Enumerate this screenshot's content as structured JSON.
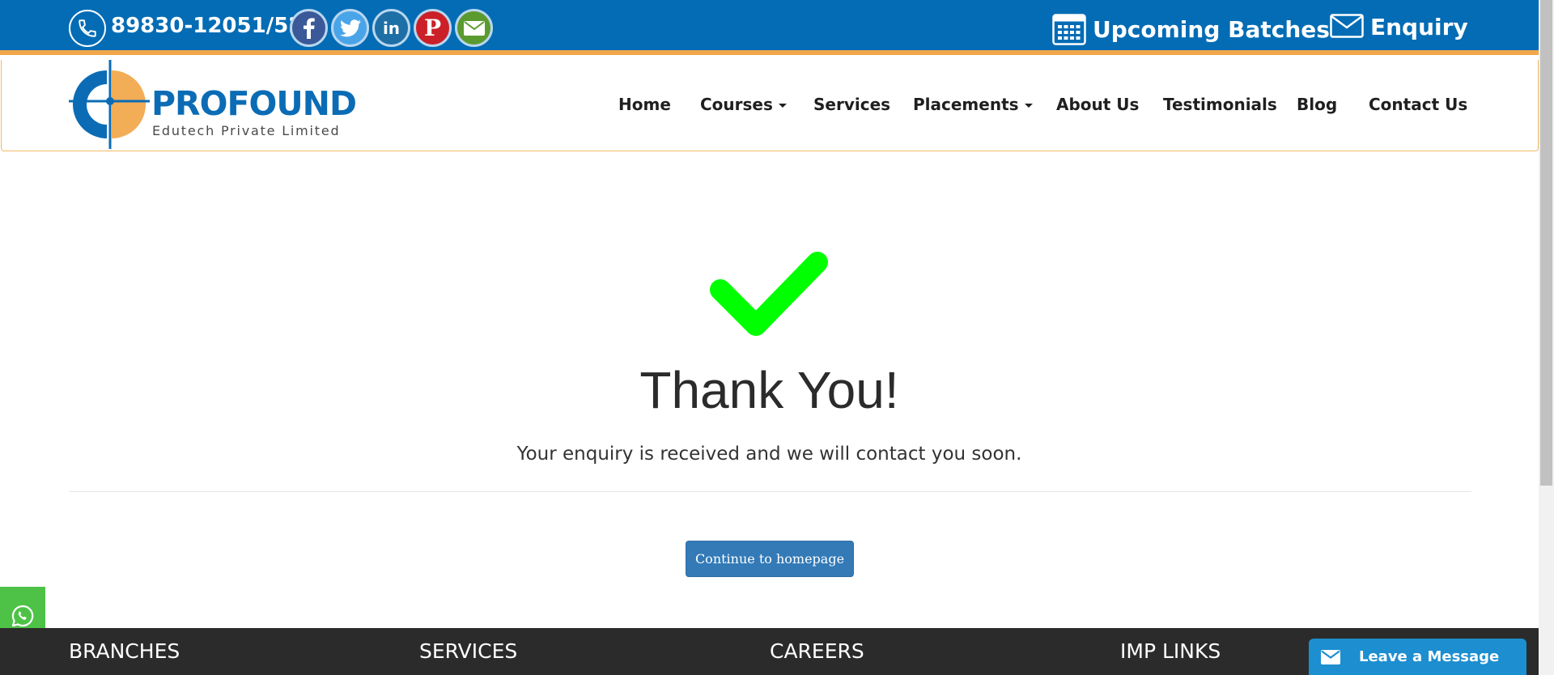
{
  "topbar": {
    "phone": "89830-12051/52",
    "upcoming_batches": "Upcoming Batches",
    "enquiry": "Enquiry",
    "social_icons": [
      "facebook-icon",
      "twitter-icon",
      "linkedin-icon",
      "pinterest-icon",
      "email-icon"
    ]
  },
  "logo": {
    "name": "PROFOUND",
    "tagline": "Edutech Private Limited"
  },
  "nav": {
    "items": [
      {
        "label": "Home"
      },
      {
        "label": "Courses"
      },
      {
        "label": "Services"
      },
      {
        "label": "Placements"
      },
      {
        "label": "About Us"
      },
      {
        "label": "Testimonials"
      },
      {
        "label": "Blog"
      },
      {
        "label": "Contact Us"
      }
    ]
  },
  "main": {
    "title": "Thank You!",
    "message": "Your enquiry is received and we will contact you soon.",
    "button": "Continue to homepage"
  },
  "footer": {
    "headings": [
      "BRANCHES",
      "SERVICES",
      "CAREERS",
      "IMP LINKS"
    ]
  },
  "chat": {
    "label": "Leave a Message"
  },
  "colors": {
    "topbar": "#036cb5",
    "accent_orange": "#f0a84b",
    "check_green": "#00ff00",
    "button_blue": "#337ab7",
    "footer_bg": "#2b2b2b",
    "whatsapp_green": "#4dc247",
    "chat_blue": "#1d8ecf"
  }
}
